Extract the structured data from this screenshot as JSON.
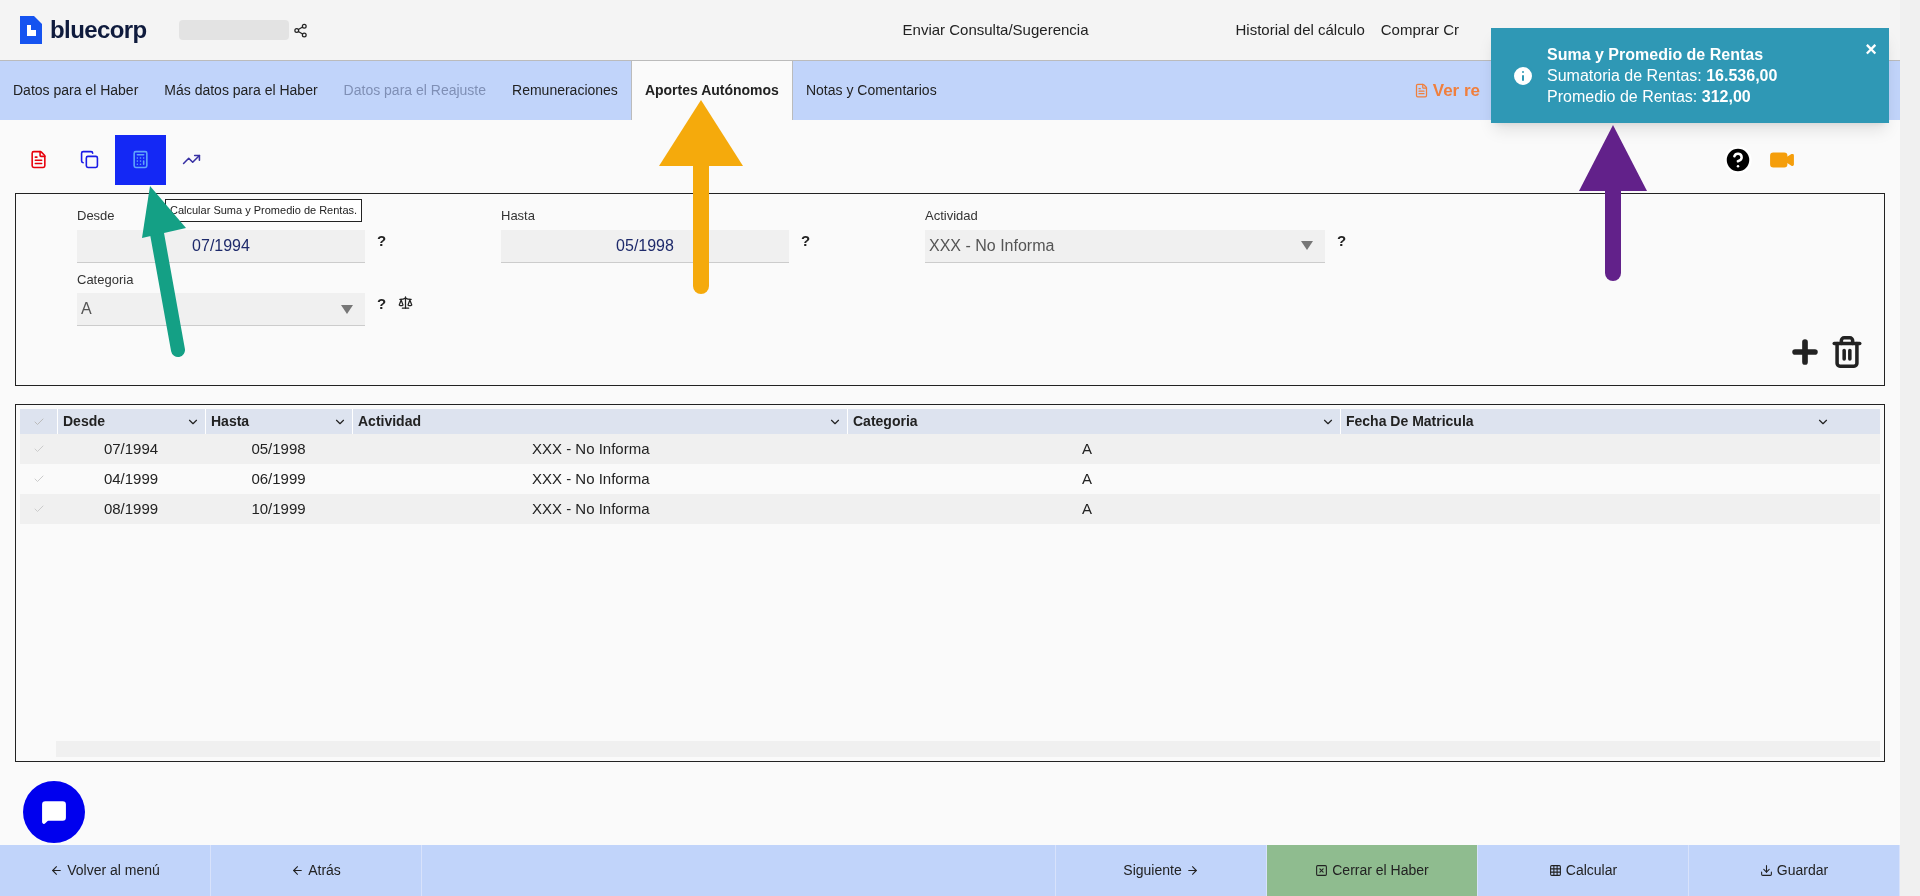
{
  "header": {
    "logo_text": "bluecorp",
    "links": [
      "Enviar Consulta/Sugerencia",
      "Historial del cálculo",
      "Comprar Cr"
    ]
  },
  "tabs": [
    {
      "label": "Datos para el Haber",
      "selected": false,
      "disabled": false
    },
    {
      "label": "Más datos para el Haber",
      "selected": false,
      "disabled": false
    },
    {
      "label": "Datos para el Reajuste",
      "selected": false,
      "disabled": true
    },
    {
      "label": "Remuneraciones",
      "selected": false,
      "disabled": false
    },
    {
      "label": "Aportes Autónomos",
      "selected": true,
      "disabled": false
    },
    {
      "label": "Notas y Comentarios",
      "selected": false,
      "disabled": false
    }
  ],
  "report_link": "Ver re",
  "toast": {
    "title": "Suma y Promedio de Rentas",
    "lines": [
      "Sumatoria de Rentas: **16.536,00**",
      "Promedio de Rentas: **312,00**"
    ],
    "close": "×"
  },
  "toolbar": [
    {
      "kind": "pdf",
      "selected": false
    },
    {
      "kind": "copy",
      "selected": false
    },
    {
      "kind": "calculator",
      "selected": true
    },
    {
      "kind": "chart",
      "selected": false
    }
  ],
  "tooltip": "Calcular Suma y Promedio de Rentas.",
  "form": {
    "fields": [
      {
        "label": "Desde",
        "value": "07/1994",
        "kind": "text",
        "help": "?"
      },
      {
        "label": "Hasta",
        "value": "05/1998",
        "kind": "text",
        "help": "?"
      },
      {
        "label": "Actividad",
        "value": "XXX - No Informa",
        "kind": "select",
        "help": "?"
      },
      {
        "label": "Categoria",
        "value": "A",
        "kind": "select",
        "help": "?",
        "scale_icon": true
      }
    ]
  },
  "table": {
    "all_selected": false,
    "columns": [
      "Desde",
      "Hasta",
      "Actividad",
      "Categoria",
      "Fecha De Matricula"
    ],
    "rows": [
      {
        "selected": false,
        "cells": [
          "07/1994",
          "05/1998",
          "XXX - No Informa",
          "A"
        ]
      },
      {
        "selected": false,
        "cells": [
          "04/1999",
          "06/1999",
          "XXX - No Informa",
          "A"
        ]
      },
      {
        "selected": false,
        "cells": [
          "08/1999",
          "10/1999",
          "XXX - No Informa",
          "A"
        ]
      }
    ]
  },
  "footer": [
    {
      "label": "Volver al menú",
      "kind": "back"
    },
    {
      "label": "Atrás",
      "kind": "back"
    },
    {
      "label": "Siguiente",
      "kind": "next"
    },
    {
      "label": "Cerrar el Haber",
      "kind": "close"
    },
    {
      "label": "Calcular",
      "kind": "grid"
    },
    {
      "label": "Guardar",
      "kind": "download"
    }
  ]
}
